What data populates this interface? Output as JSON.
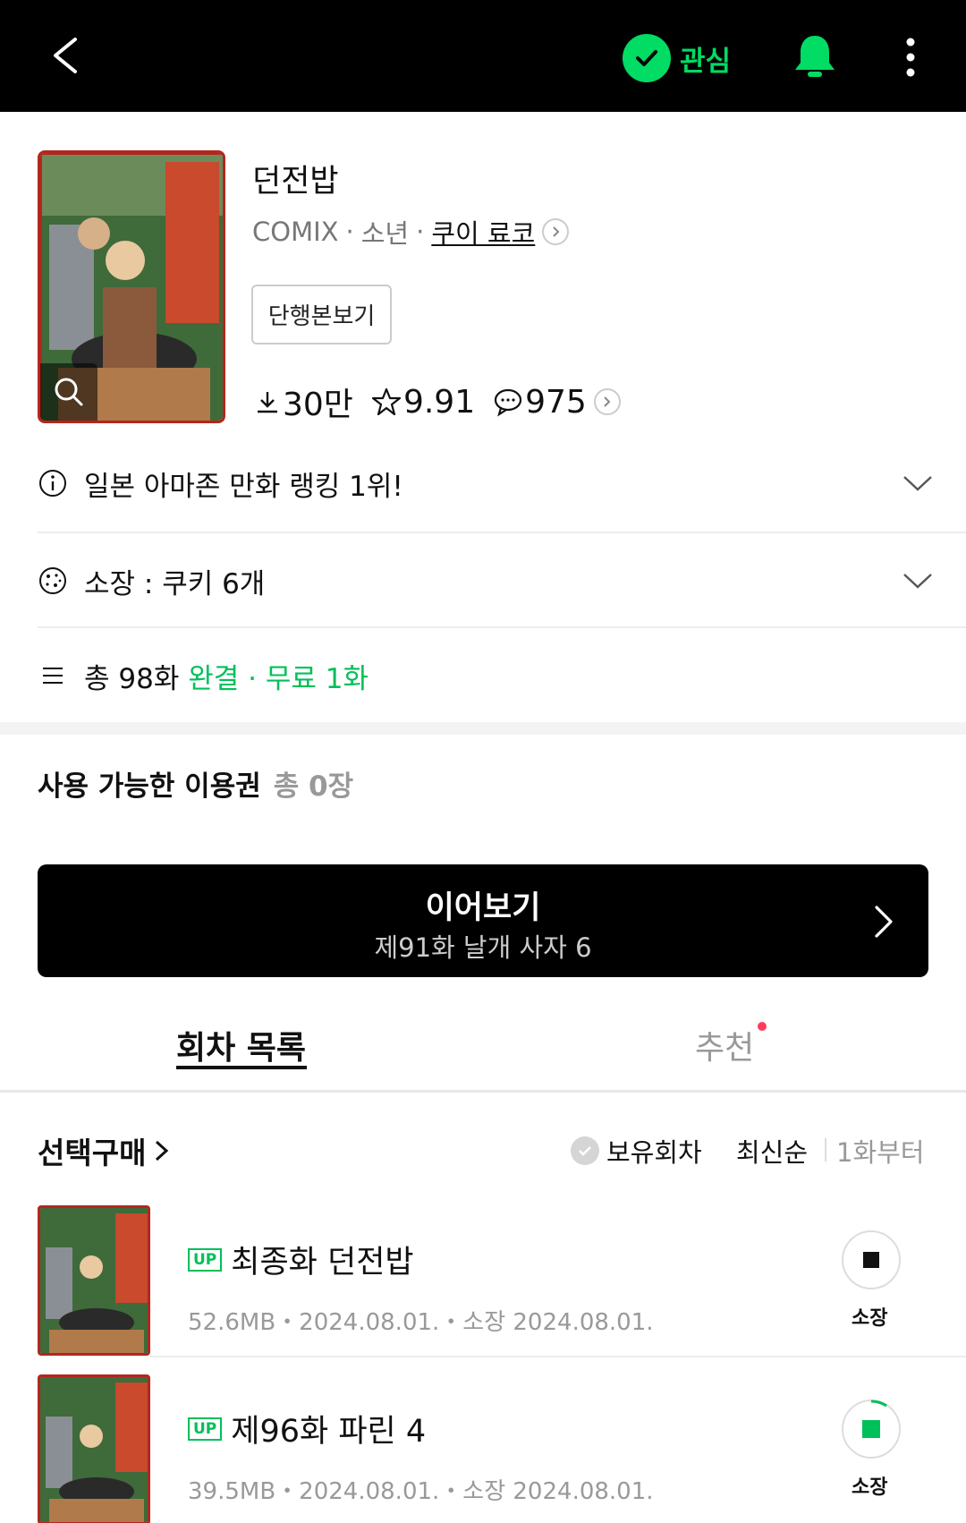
{
  "header": {
    "favorite_label": "관심",
    "icons": {
      "back": "back-arrow-icon",
      "favorite": "check-circle-icon",
      "bell": "bell-icon",
      "more": "more-vertical-icon"
    },
    "accent_color": "#00dc64"
  },
  "title": {
    "name": "던전밥",
    "category": "COMIX",
    "genre": "소년",
    "author": "쿠이 료코",
    "volume_button": "단행본보기",
    "downloads": "30만",
    "rating": "9.91",
    "comments": "975"
  },
  "info": {
    "promo": "일본 아마존 만화 랭킹 1위!",
    "owned": "소장 : 쿠키 6개",
    "episodes_total": "총 98화",
    "status": "완결",
    "free": "무료 1화"
  },
  "ticket": {
    "label": "사용 가능한 이용권",
    "count": "총 0장"
  },
  "continue": {
    "label": "이어보기",
    "episode": "제91화 날개 사자 6"
  },
  "tabs": [
    {
      "label": "회차 목록",
      "active": true
    },
    {
      "label": "추천",
      "active": false
    }
  ],
  "list_controls": {
    "select_buy": "선택구매",
    "owned_filter": "보유회차",
    "sort_newest": "최신순",
    "sort_first": "1화부터"
  },
  "episodes": [
    {
      "badge": "UP",
      "title": "최종화 던전밥",
      "info": "52.6MB・2024.08.01.・소장 2024.08.01.",
      "action": "소장"
    },
    {
      "badge": "UP",
      "title": "제96화 파린 4",
      "info": "39.5MB・2024.08.01.・소장 2024.08.01.",
      "action": "소장"
    }
  ]
}
